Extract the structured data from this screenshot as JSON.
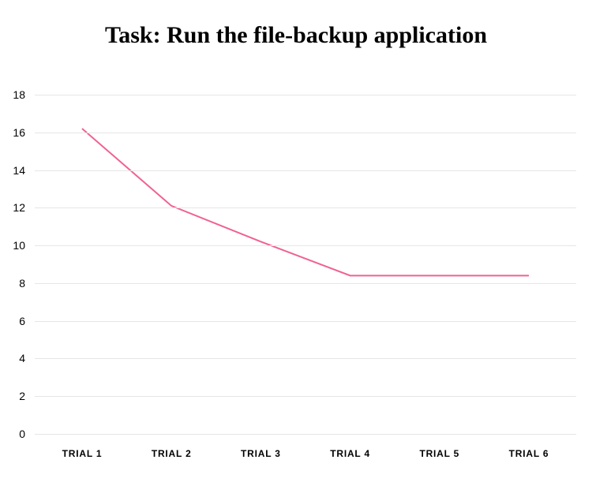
{
  "chart_data": {
    "type": "line",
    "title": "Task: Run the file-backup application",
    "categories": [
      "TRIAL 1",
      "TRIAL 2",
      "TRIAL 3",
      "TRIAL 4",
      "TRIAL 5",
      "TRIAL 6"
    ],
    "values": [
      16.2,
      12.1,
      10.2,
      8.4,
      8.4,
      8.4
    ],
    "xlabel": "",
    "ylabel": "",
    "ylim": [
      0,
      18
    ],
    "yticks": [
      0,
      2,
      4,
      6,
      8,
      10,
      12,
      14,
      16,
      18
    ],
    "line_color": "#f06292"
  }
}
